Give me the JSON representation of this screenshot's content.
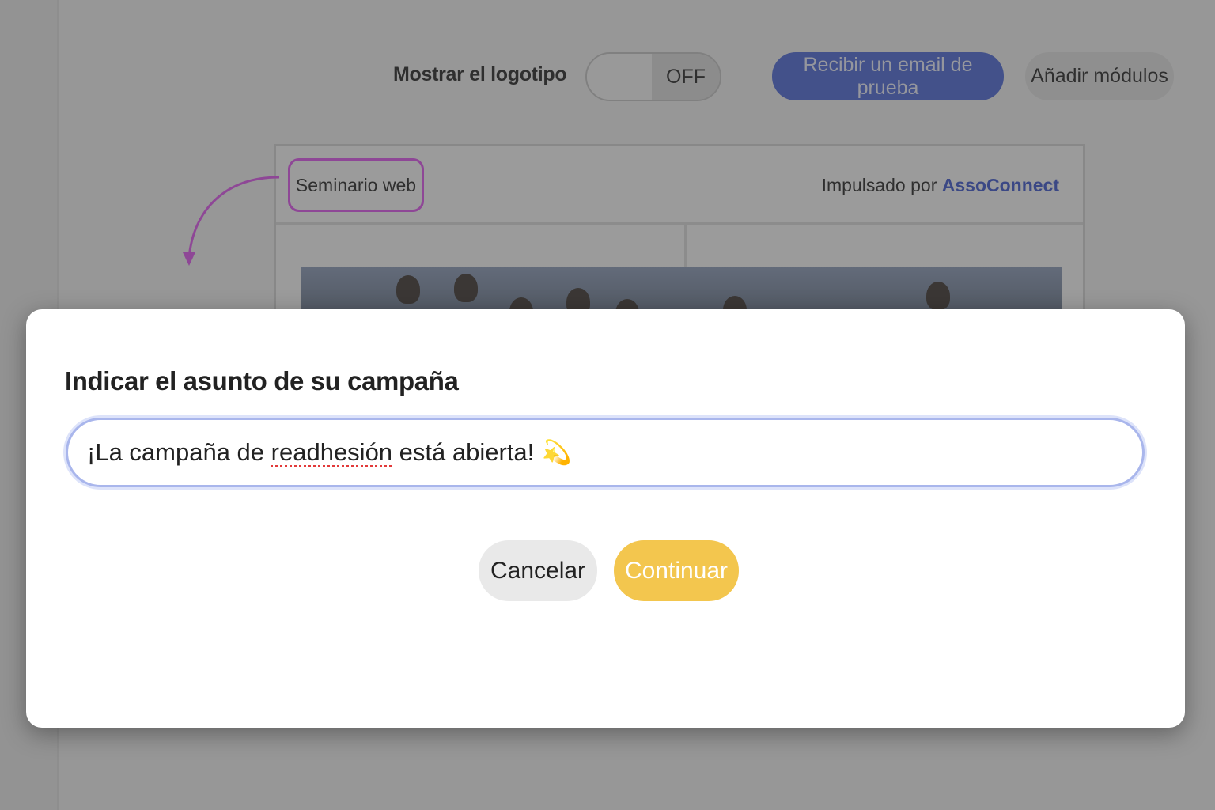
{
  "toolbar": {
    "logo_label": "Mostrar el logotipo",
    "logo_toggle_state": "OFF",
    "test_email_button": "Recibir un email de prueba",
    "add_modules_button": "Añadir módulos"
  },
  "email_preview": {
    "chip_label": "Seminario web",
    "powered_prefix": "Impulsado por",
    "powered_brand": "AssoConnect"
  },
  "modal": {
    "title": "Indicar el asunto de su campaña",
    "subject": {
      "text_before": "¡La campaña de ",
      "misspelled_word": "readhesión",
      "text_after": " está abierta!",
      "emoji": "💫"
    },
    "cancel_button": "Cancelar",
    "continue_button": "Continuar"
  },
  "colors": {
    "primary": "#4a67d8",
    "accent": "#f3c64e",
    "annotation": "#e052f0",
    "brand_link": "#3a55cf"
  }
}
